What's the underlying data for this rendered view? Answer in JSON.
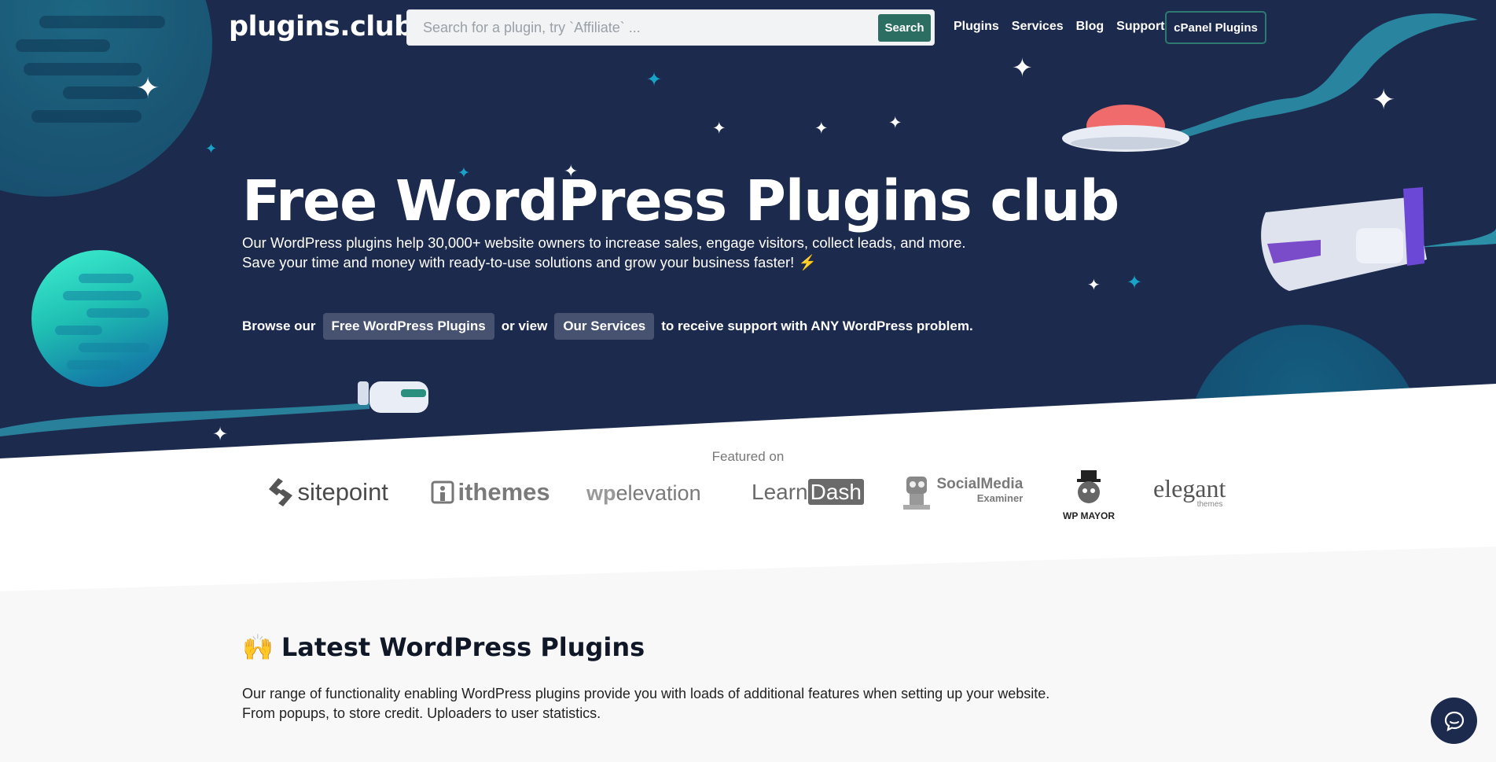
{
  "header": {
    "logo": "plugins.club",
    "search": {
      "placeholder": "Search for a plugin, try `Affiliate` ...",
      "button_label": "Search"
    },
    "nav": [
      {
        "label": "Plugins"
      },
      {
        "label": "Services"
      },
      {
        "label": "Blog"
      },
      {
        "label": "Support"
      }
    ],
    "cpanel_label": "cPanel Plugins"
  },
  "hero": {
    "title": "Free WordPress Plugins club",
    "subtitle_line1": "Our WordPress plugins help 30,000+ website owners to increase sales, engage visitors, collect leads, and more.",
    "subtitle_line2": "Save your time and money with ready-to-use solutions and grow your business faster! ⚡",
    "browse_prefix": "Browse our",
    "free_plugins_label": "Free WordPress Plugins",
    "or_view": "or view",
    "services_label": "Our Services",
    "browse_suffix": "to receive support with ANY WordPress problem."
  },
  "featured": {
    "label": "Featured on",
    "brands": [
      {
        "name": "sitepoint",
        "icon": "sitepoint-logo-icon"
      },
      {
        "name": "ithemes",
        "icon": "ithemes-logo-icon"
      },
      {
        "name": "wpelevation",
        "prefix": "wp",
        "rest": "elevation"
      },
      {
        "name": "LearnDash",
        "part1": "Learn",
        "part2": "Dash"
      },
      {
        "name": "Social Media Examiner",
        "line1": "SocialMedia",
        "line2": "Examiner",
        "icon": "robot-mascot-icon"
      },
      {
        "name": "WP MAYOR",
        "icon": "top-hat-mascot-icon"
      },
      {
        "name": "elegant themes",
        "line1": "elegant",
        "line2": "themes"
      }
    ]
  },
  "latest": {
    "emoji": "🙌",
    "title": "Latest WordPress Plugins",
    "desc_line1": "Our range of functionality enabling WordPress plugins provide you with loads of additional features when setting up your website.",
    "desc_line2": "From popups, to store credit. Uploaders to user statistics."
  },
  "colors": {
    "hero_bg": "#1c2a4d",
    "accent": "#2d6e63",
    "pill_bg": "#46526f"
  }
}
